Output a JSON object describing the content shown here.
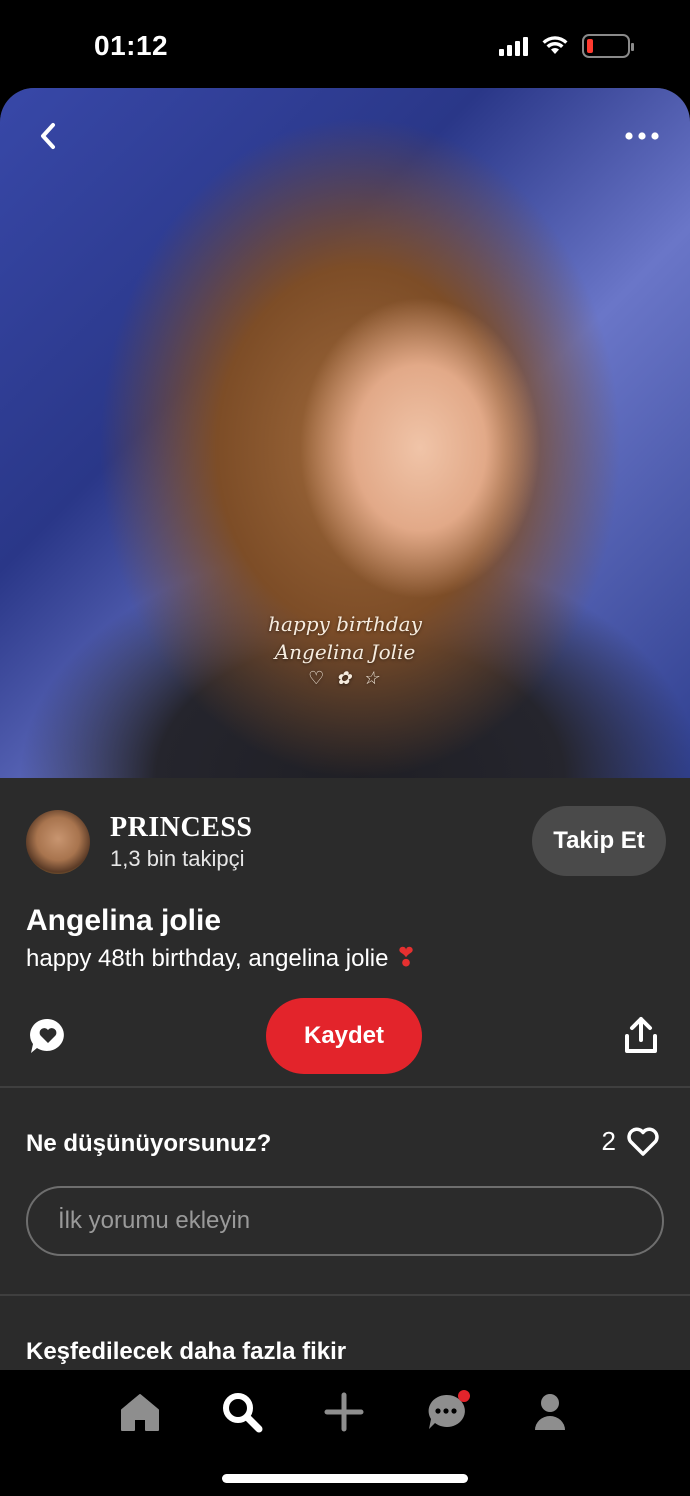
{
  "status_bar": {
    "time": "01:12",
    "icons": [
      "cellular-signal-icon",
      "wifi-icon",
      "battery-low-icon"
    ],
    "battery_color": "#ff3b30"
  },
  "pin": {
    "image_overlay_text": {
      "line1": "happy birthday",
      "line2": "Angelina Jolie",
      "line3": "♡ ✿ ☆"
    },
    "back_icon": "chevron-left-icon",
    "more_icon": "more-horizontal-icon",
    "author": {
      "name": "PRINCESS",
      "followers": "1,3 bin takipçi",
      "follow_label": "Takip Et"
    },
    "title": "Angelina jolie",
    "description": "happy 48th birthday, angelina jolie",
    "description_emoji": "❣",
    "save_label": "Kaydet",
    "save_color": "#e3242b"
  },
  "comments": {
    "heading": "Ne düşünüyorsunuz?",
    "reaction_count": "2",
    "input_placeholder": "İlk yorumu ekleyin"
  },
  "more_ideas": {
    "heading": "Keşfedilecek daha fazla fikir"
  },
  "bottom_nav": {
    "items": [
      "home-icon",
      "search-icon",
      "add-icon",
      "messages-icon",
      "profile-icon"
    ],
    "active": "search-icon"
  }
}
